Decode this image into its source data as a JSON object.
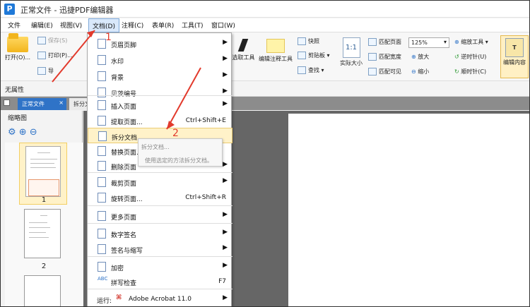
{
  "window": {
    "title": "正常文件 - 迅捷PDF编辑器",
    "logo_text": "P"
  },
  "menu": [
    "文件",
    "编辑(E)",
    "视图(V)",
    "文档(D)",
    "注释(C)",
    "表单(R)",
    "工具(T)",
    "窗口(W)"
  ],
  "ribbon": {
    "open": "打开(O)...",
    "left_small": [
      "保存(S)",
      "打印(P)...",
      "导"
    ],
    "select_tools": [
      "选取工具",
      "编辑注释工具"
    ],
    "snapshot": [
      "快照",
      "剪贴板",
      "查找"
    ],
    "actual": "实际大小",
    "fit": [
      "匹配页面",
      "匹配宽度",
      "匹配可见"
    ],
    "zoom_value": "125%",
    "zoom": [
      "放大",
      "缩小",
      "缩放工具",
      "逆时针(U)",
      "顺时针(C)"
    ],
    "edit_content": "编辑内容"
  },
  "props": "无属性",
  "tabs": [
    "正常文件",
    "拆分文"
  ],
  "sidebar": {
    "title": "缩略图",
    "pages": [
      "1",
      "2"
    ]
  },
  "dropdown": [
    {
      "label": "页眉页脚",
      "shortcut": "",
      "arrow": true
    },
    {
      "label": "水印",
      "shortcut": "",
      "arrow": true
    },
    {
      "label": "背景",
      "shortcut": "",
      "arrow": true
    },
    {
      "label": "贝茨编号",
      "shortcut": "",
      "arrow": true
    },
    {
      "label": "插入页面",
      "shortcut": "",
      "arrow": true
    },
    {
      "label": "提取页面...",
      "shortcut": "Ctrl+Shift+E",
      "arrow": false
    },
    {
      "label": "拆分文档...",
      "shortcut": "",
      "arrow": false
    },
    {
      "label": "替换页面...",
      "shortcut": "",
      "arrow": false
    },
    {
      "label": "删除页面",
      "shortcut": "",
      "arrow": true
    },
    {
      "label": "裁剪页面",
      "shortcut": "",
      "arrow": true
    },
    {
      "label": "旋转页面...",
      "shortcut": "Ctrl+Shift+R",
      "arrow": false
    },
    {
      "label": "更多页面",
      "shortcut": "",
      "arrow": true
    },
    {
      "label": "数字签名",
      "shortcut": "",
      "arrow": true
    },
    {
      "label": "签名与缩写",
      "shortcut": "",
      "arrow": true
    },
    {
      "label": "加密",
      "shortcut": "",
      "arrow": true
    },
    {
      "label": "拼写检查",
      "shortcut": "F7",
      "arrow": false
    },
    {
      "label": "运行:",
      "shortcut": "",
      "arrow": true
    }
  ],
  "run_app": "Adobe Acrobat 11.0",
  "tooltip": {
    "title": "拆分文档...",
    "desc": "使用选定的方法拆分文档。"
  },
  "annotations": {
    "one": "1",
    "two": "2"
  },
  "colors": {
    "accent": "#2f73c7",
    "highlight": "#fff2c9",
    "annotation": "#e23a2c"
  }
}
